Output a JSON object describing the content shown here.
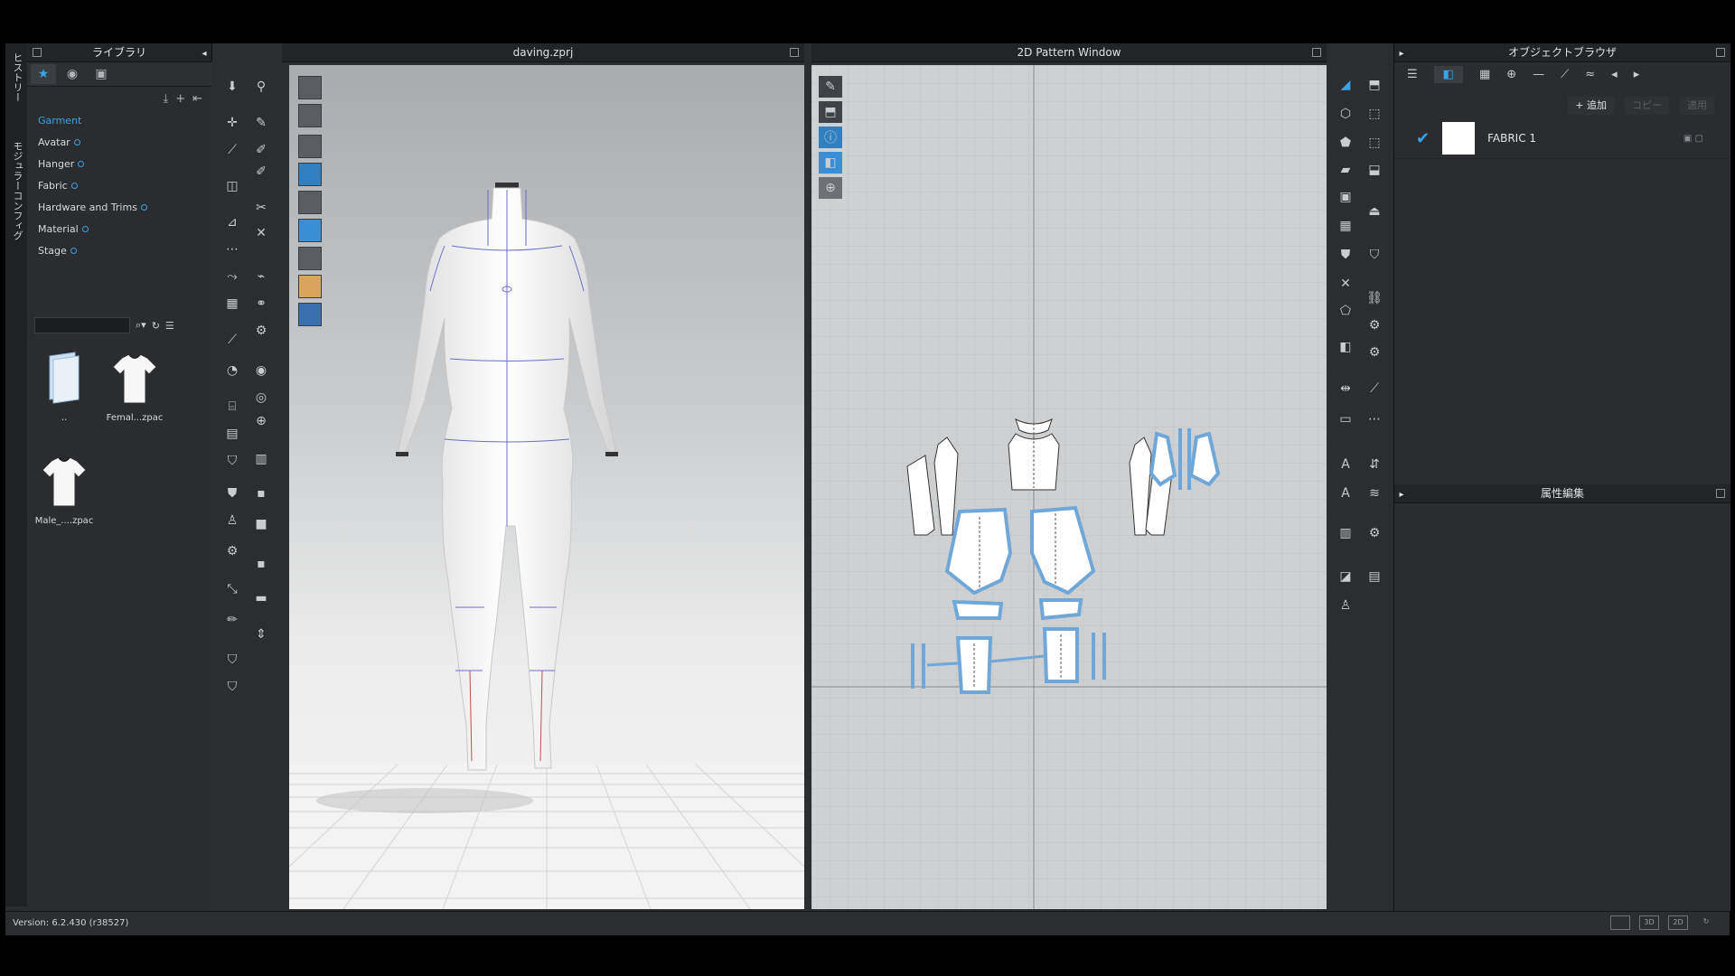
{
  "library": {
    "title": "ライブラリ",
    "vertical_tabs": [
      "ヒストリー",
      "モジュラーコンフィグ"
    ],
    "tabs": [
      "star-icon",
      "eye-icon",
      "folder-icon"
    ],
    "categories": [
      {
        "label": "Garment",
        "active": true
      },
      {
        "label": "Avatar"
      },
      {
        "label": "Hanger"
      },
      {
        "label": "Fabric"
      },
      {
        "label": "Hardware and Trims"
      },
      {
        "label": "Material"
      },
      {
        "label": "Stage"
      }
    ],
    "search_placeholder": "",
    "files": [
      {
        "name": "..",
        "icon": "folder-icon"
      },
      {
        "name": "Femal...zpac",
        "icon": "tshirt-icon"
      },
      {
        "name": "Male_....zpac",
        "icon": "tshirt-icon"
      }
    ]
  },
  "viewport3d": {
    "title": "daving.zprj"
  },
  "viewport2d": {
    "title": "2D Pattern Window"
  },
  "object_browser": {
    "title": "オブジェクトブラウザ",
    "add_label": "+ 追加",
    "copy_label": "コピー",
    "apply_label": "適用",
    "fabrics": [
      {
        "name": "FABRIC 1",
        "checked": true,
        "color": "#ffffff"
      }
    ]
  },
  "property_editor": {
    "title": "属性編集"
  },
  "status": {
    "version": "Version: 6.2.430 (r38527)",
    "view_modes": [
      "",
      "3D",
      "2D",
      ""
    ]
  },
  "colors": {
    "accent": "#3aa3e6",
    "panel": "#2b2d30",
    "pattern_outline": "#6fa8d8"
  }
}
